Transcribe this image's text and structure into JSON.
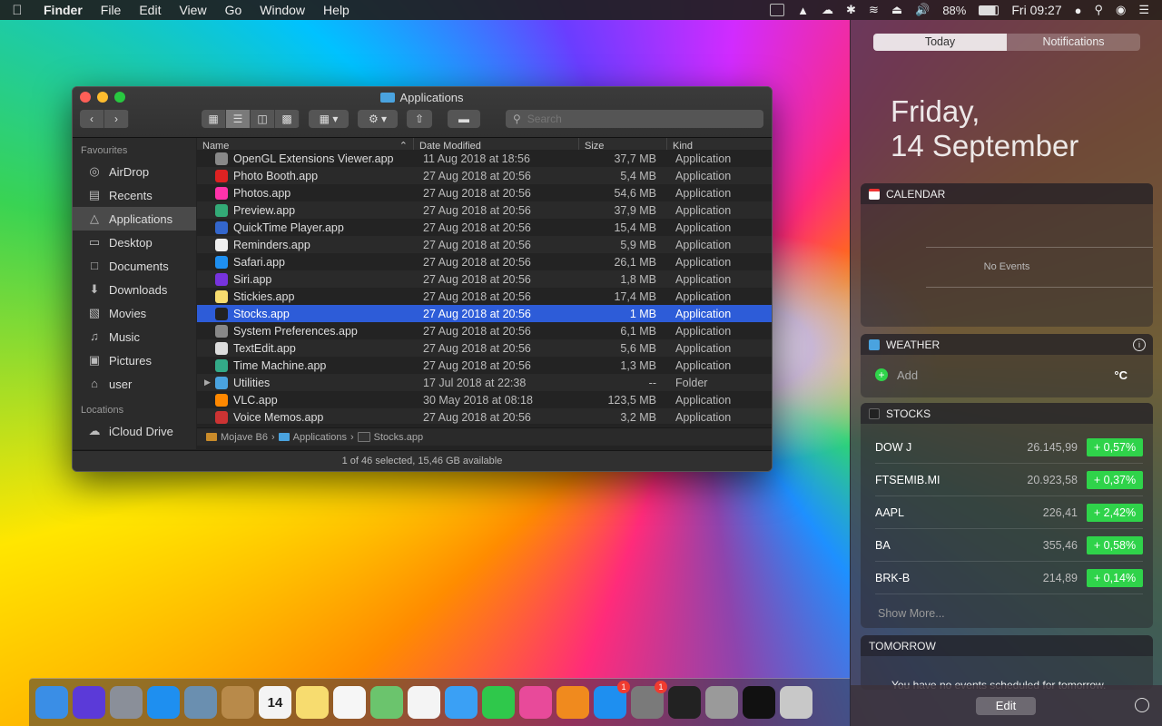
{
  "menubar": {
    "app": "Finder",
    "items": [
      "File",
      "Edit",
      "View",
      "Go",
      "Window",
      "Help"
    ],
    "battery": "88%",
    "clock": "Fri 09:27"
  },
  "finder": {
    "title": "Applications",
    "search_placeholder": "Search",
    "sidebar": {
      "favourites_header": "Favourites",
      "favourites": [
        {
          "label": "AirDrop",
          "icon": "airdrop-icon"
        },
        {
          "label": "Recents",
          "icon": "recents-icon"
        },
        {
          "label": "Applications",
          "icon": "applications-icon"
        },
        {
          "label": "Desktop",
          "icon": "desktop-icon"
        },
        {
          "label": "Documents",
          "icon": "documents-icon"
        },
        {
          "label": "Downloads",
          "icon": "downloads-icon"
        },
        {
          "label": "Movies",
          "icon": "movies-icon"
        },
        {
          "label": "Music",
          "icon": "music-icon"
        },
        {
          "label": "Pictures",
          "icon": "pictures-icon"
        },
        {
          "label": "user",
          "icon": "home-icon"
        }
      ],
      "locations_header": "Locations",
      "locations": [
        {
          "label": "iCloud Drive",
          "icon": "icloud-icon"
        }
      ]
    },
    "columns": [
      "Name",
      "Date Modified",
      "Size",
      "Kind"
    ],
    "rows": [
      {
        "name": "OpenGL Extensions Viewer.app",
        "date": "11 Aug 2018 at 18:56",
        "size": "37,7 MB",
        "kind": "Application"
      },
      {
        "name": "Photo Booth.app",
        "date": "27 Aug 2018 at 20:56",
        "size": "5,4 MB",
        "kind": "Application"
      },
      {
        "name": "Photos.app",
        "date": "27 Aug 2018 at 20:56",
        "size": "54,6 MB",
        "kind": "Application"
      },
      {
        "name": "Preview.app",
        "date": "27 Aug 2018 at 20:56",
        "size": "37,9 MB",
        "kind": "Application"
      },
      {
        "name": "QuickTime Player.app",
        "date": "27 Aug 2018 at 20:56",
        "size": "15,4 MB",
        "kind": "Application"
      },
      {
        "name": "Reminders.app",
        "date": "27 Aug 2018 at 20:56",
        "size": "5,9 MB",
        "kind": "Application"
      },
      {
        "name": "Safari.app",
        "date": "27 Aug 2018 at 20:56",
        "size": "26,1 MB",
        "kind": "Application"
      },
      {
        "name": "Siri.app",
        "date": "27 Aug 2018 at 20:56",
        "size": "1,8 MB",
        "kind": "Application"
      },
      {
        "name": "Stickies.app",
        "date": "27 Aug 2018 at 20:56",
        "size": "17,4 MB",
        "kind": "Application"
      },
      {
        "name": "Stocks.app",
        "date": "27 Aug 2018 at 20:56",
        "size": "1 MB",
        "kind": "Application"
      },
      {
        "name": "System Preferences.app",
        "date": "27 Aug 2018 at 20:56",
        "size": "6,1 MB",
        "kind": "Application"
      },
      {
        "name": "TextEdit.app",
        "date": "27 Aug 2018 at 20:56",
        "size": "5,6 MB",
        "kind": "Application"
      },
      {
        "name": "Time Machine.app",
        "date": "27 Aug 2018 at 20:56",
        "size": "1,3 MB",
        "kind": "Application"
      },
      {
        "name": "Utilities",
        "date": "17 Jul 2018 at 22:38",
        "size": "--",
        "kind": "Folder"
      },
      {
        "name": "VLC.app",
        "date": "30 May 2018 at 08:18",
        "size": "123,5 MB",
        "kind": "Application"
      },
      {
        "name": "Voice Memos.app",
        "date": "27 Aug 2018 at 20:56",
        "size": "3,2 MB",
        "kind": "Application"
      }
    ],
    "pathbar": [
      "Mojave B6",
      "Applications",
      "Stocks.app"
    ],
    "status": "1 of 46 selected, 15,46 GB available"
  },
  "nc": {
    "tab_today": "Today",
    "tab_notifications": "Notifications",
    "date_line1": "Friday,",
    "date_line2": "14 September",
    "calendar": {
      "title": "CALENDAR",
      "empty": "No Events"
    },
    "weather": {
      "title": "WEATHER",
      "add": "Add",
      "unit": "°C"
    },
    "stocks": {
      "title": "STOCKS",
      "rows": [
        {
          "symbol": "DOW J",
          "price": "26.145,99",
          "change": "+ 0,57%"
        },
        {
          "symbol": "FTSEMIB.MI",
          "price": "20.923,58",
          "change": "+ 0,37%"
        },
        {
          "symbol": "AAPL",
          "price": "226,41",
          "change": "+ 2,42%"
        },
        {
          "symbol": "BA",
          "price": "355,46",
          "change": "+ 0,58%"
        },
        {
          "symbol": "BRK-B",
          "price": "214,89",
          "change": "+ 0,14%"
        }
      ],
      "show_more": "Show More..."
    },
    "tomorrow": {
      "title": "TOMORROW",
      "text": "You have no events scheduled for tomorrow."
    },
    "edit": "Edit"
  },
  "dock": {
    "items": [
      {
        "icon": "finder-icon",
        "color": "#3a8ee6"
      },
      {
        "icon": "siri-icon",
        "color": "#5b3ad8"
      },
      {
        "icon": "launchpad-icon",
        "color": "#8a8f99"
      },
      {
        "icon": "safari-icon",
        "color": "#1e8ff0"
      },
      {
        "icon": "mail-icon",
        "color": "#6a8fb0"
      },
      {
        "icon": "contacts-icon",
        "color": "#b88a4a"
      },
      {
        "icon": "calendar-icon",
        "color": "#f4f4f4",
        "text": "14"
      },
      {
        "icon": "notes-icon",
        "color": "#f7dc6f"
      },
      {
        "icon": "reminders-icon",
        "color": "#f6f6f6"
      },
      {
        "icon": "maps-icon",
        "color": "#6bc46d"
      },
      {
        "icon": "photos-icon",
        "color": "#f4f4f4"
      },
      {
        "icon": "messages-icon",
        "color": "#3aa0f5"
      },
      {
        "icon": "facetime-icon",
        "color": "#2fc84b"
      },
      {
        "icon": "itunes-icon",
        "color": "#e84a9a"
      },
      {
        "icon": "books-icon",
        "color": "#f08a1e"
      },
      {
        "icon": "app-store-icon",
        "color": "#1e8ff0",
        "badge": "1"
      },
      {
        "icon": "system-preferences-icon",
        "color": "#7a7a7a",
        "badge": "1"
      },
      {
        "icon": "activity-monitor-icon",
        "color": "#222222"
      },
      {
        "icon": "disk-utility-icon",
        "color": "#9a9a9a"
      },
      {
        "icon": "terminal-icon",
        "color": "#111111"
      },
      {
        "icon": "archive-utility-icon",
        "color": "#c8c8c8"
      }
    ]
  }
}
